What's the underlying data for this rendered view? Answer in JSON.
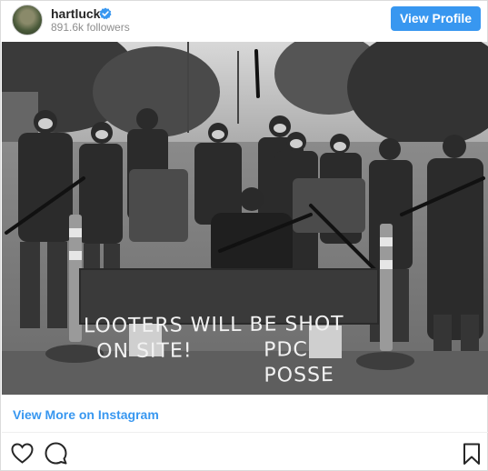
{
  "header": {
    "username": "hartluck",
    "followers": "891.6k followers",
    "view_profile_label": "View Profile"
  },
  "photo": {
    "sign_line1": "LOOTERS WILL BE SHOT",
    "sign_line2a": "ON SITE!",
    "sign_line2b": "PDC POSSE"
  },
  "footer": {
    "view_more_label": "View More on Instagram"
  },
  "icons": {
    "verified": "verified-badge-icon",
    "like": "heart-icon",
    "comment": "comment-icon",
    "save": "bookmark-icon"
  },
  "colors": {
    "accent": "#3897f0",
    "text": "#262626",
    "muted": "#8e8e8e"
  }
}
